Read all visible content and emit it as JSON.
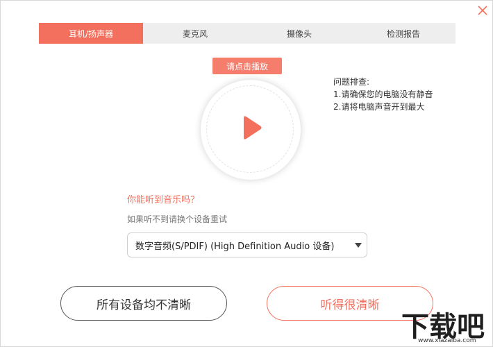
{
  "tabs": [
    {
      "label": "耳机/扬声器",
      "active": true
    },
    {
      "label": "麦克风",
      "active": false
    },
    {
      "label": "摄像头",
      "active": false
    },
    {
      "label": "检测报告",
      "active": false
    }
  ],
  "player": {
    "tip": "请点击播放",
    "icon": "play-icon",
    "accent": "#f2705d"
  },
  "troubleshoot": {
    "title": "问题排查:",
    "items": [
      "1.请确保您的电脑没有静音",
      "2.请将电脑声音开到最大"
    ]
  },
  "question": "你能听到音乐吗？",
  "hint": "如果听不到请换个设备重试",
  "device_select": {
    "value": "数字音频(S/PDIF) (High Definition Audio 设备)"
  },
  "buttons": {
    "unclear": "所有设备均不清晰",
    "clear": "听得很清晰"
  },
  "watermark": {
    "text": "下载吧",
    "url": "www.xiazaiba.com"
  }
}
